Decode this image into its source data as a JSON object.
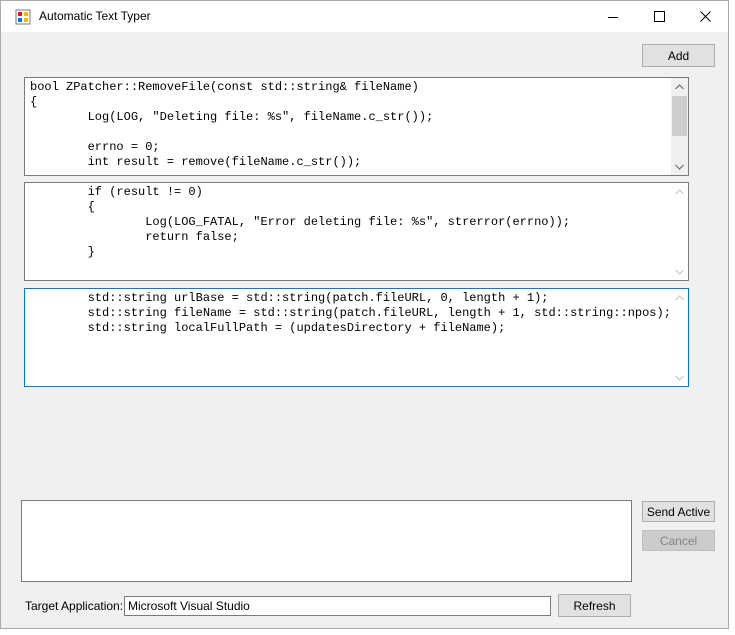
{
  "window": {
    "title": "Automatic Text Typer"
  },
  "toolbar": {
    "add_label": "Add"
  },
  "snippets": [
    {
      "code": "bool ZPatcher::RemoveFile(const std::string& fileName)\n{\n        Log(LOG, \"Deleting file: %s\", fileName.c_str());\n\n        errno = 0;\n        int result = remove(fileName.c_str());"
    },
    {
      "code": "        if (result != 0)\n        {\n                Log(LOG_FATAL, \"Error deleting file: %s\", strerror(errno));\n                return false;\n        }"
    },
    {
      "code": "        std::string urlBase = std::string(patch.fileURL, 0, length + 1);\n        std::string fileName = std::string(patch.fileURL, length + 1, std::string::npos);\n        std::string localFullPath = (updatesDirectory + fileName);"
    }
  ],
  "actions": {
    "send_active_label": "Send Active",
    "cancel_label": "Cancel",
    "refresh_label": "Refresh"
  },
  "target": {
    "label": "Target Application:",
    "value": "Microsoft Visual Studio"
  },
  "colors": {
    "window_bg": "#f0f0f0",
    "focus_border": "#0078d7",
    "disabled_text": "#838383"
  },
  "icons": {
    "app": "app-icon",
    "minimize": "minimize-icon",
    "maximize": "maximize-icon",
    "close": "close-icon"
  }
}
